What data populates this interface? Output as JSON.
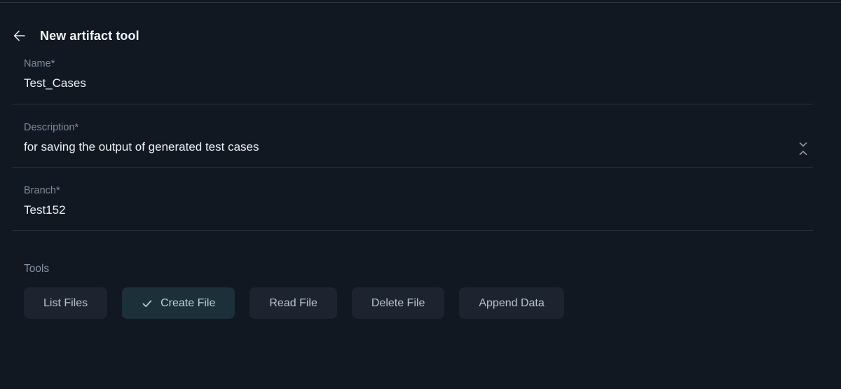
{
  "header": {
    "back_icon": "arrow-left-icon",
    "title": "New artifact tool"
  },
  "form": {
    "fields": [
      {
        "key": "name",
        "label": "Name",
        "required_marker": "*",
        "value": "Test_Cases"
      },
      {
        "key": "description",
        "label": "Description",
        "required_marker": "*",
        "value": "for saving the output of generated test cases"
      },
      {
        "key": "branch",
        "label": "Branch",
        "required_marker": "*",
        "value": "Test152"
      }
    ],
    "description_resize_icon": "chevron-expand-vertical-icon"
  },
  "tools": {
    "label": "Tools",
    "selected_icon": "check-icon",
    "items": [
      {
        "label": "List Files",
        "selected": false
      },
      {
        "label": "Create File",
        "selected": true
      },
      {
        "label": "Read File",
        "selected": false
      },
      {
        "label": "Delete File",
        "selected": false
      },
      {
        "label": "Append Data",
        "selected": false
      }
    ]
  },
  "colors": {
    "background": "#111821",
    "divider": "#2c3542",
    "label_text": "#7e8ca1",
    "value_text": "#eef2f7",
    "chip_background": "#1e242f",
    "chip_selected_background": "#1b3039",
    "chip_text": "#b9c4d3"
  }
}
